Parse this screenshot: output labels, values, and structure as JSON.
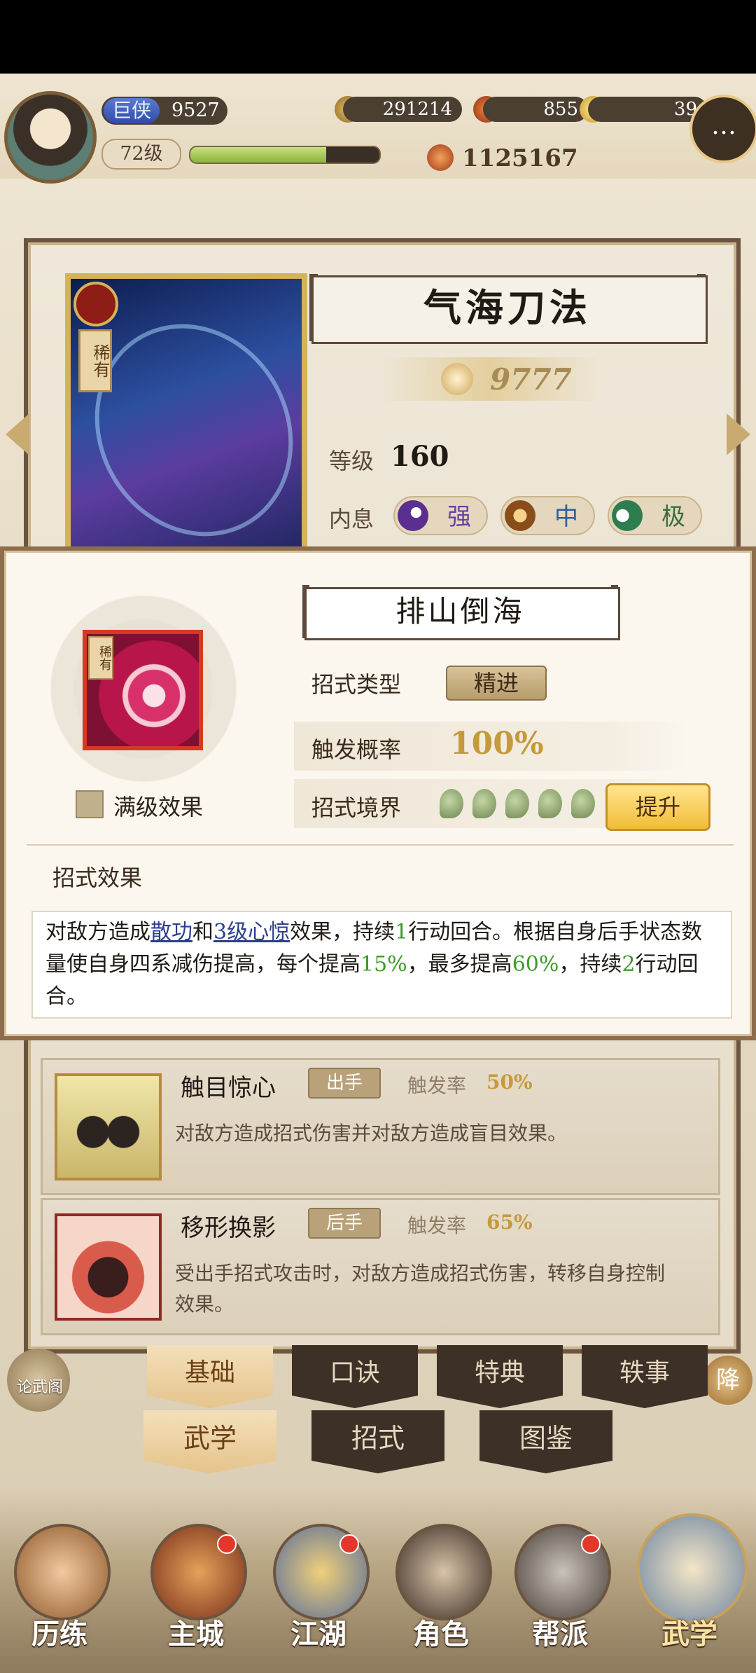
{
  "header": {
    "rank_name": "巨侠",
    "rank_points": "9527",
    "level": "72级",
    "xp_progress": 0.72,
    "coins": "291214",
    "resource2": "855",
    "gold": "39",
    "power": "1125167"
  },
  "skill": {
    "title": "气海刀法",
    "rarity": "稀有",
    "score": "9777",
    "level_label": "等级",
    "level_value": "160",
    "neili_label": "内息",
    "neili": [
      "强",
      "中",
      "极"
    ]
  },
  "popup": {
    "title": "排山倒海",
    "rarity": "稀有",
    "max_effect_label": "满级效果",
    "type_label": "招式类型",
    "type_value": "精进",
    "rate_label": "触发概率",
    "rate_value": "100%",
    "realm_label": "招式境界",
    "upgrade_label": "提升",
    "effect_header": "招式效果",
    "effect": {
      "p1": "对敌方造成",
      "l1": "散功",
      "p2": "和",
      "l2": "3级心惊",
      "p3": "效果，持续",
      "n1": "1",
      "p4": "行动回合。根据自身后手状态数量使自身四系减伤提高，每个提高",
      "n2": "15%",
      "p5": "，最多提高",
      "n3": "60%",
      "p6": "，持续",
      "n4": "2",
      "p7": "行动回合。"
    }
  },
  "moves": [
    {
      "name": "触目惊心",
      "tag": "出手",
      "rate_label": "触发率",
      "rate": "50%",
      "desc": "对敌方造成招式伤害并对敌方造成盲目效果。"
    },
    {
      "name": "移形换影",
      "tag": "后手",
      "rate_label": "触发率",
      "rate": "65%",
      "desc": "受出手招式攻击时，对敌方造成招式伤害，转移自身控制效果。"
    }
  ],
  "tabs_row1": [
    "基础",
    "口诀",
    "特典",
    "轶事"
  ],
  "tabs_row2": [
    "武学",
    "招式",
    "图鉴"
  ],
  "side": {
    "left_label": "论武阁",
    "right_label": "降"
  },
  "nav": [
    "历练",
    "主城",
    "江湖",
    "角色",
    "帮派",
    "武学"
  ],
  "colors": {
    "accent": "#e6c48c",
    "dark": "#3d3027",
    "green": "#3e9a2a",
    "link": "#2b3f8d"
  }
}
